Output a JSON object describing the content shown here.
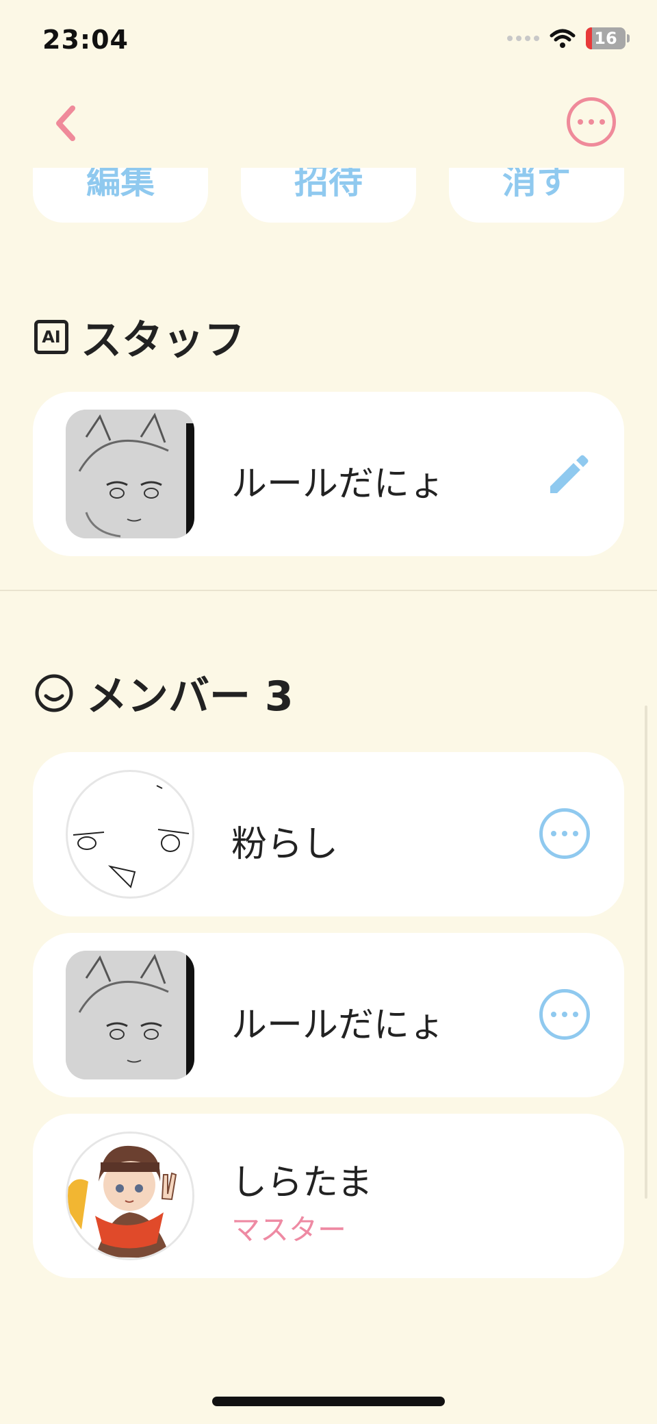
{
  "status_bar": {
    "time": "23:04",
    "battery": "16",
    "battery_level": 0.16
  },
  "nav": {
    "back_icon": "chevron-left-icon",
    "more_icon": "more-horizontal-icon"
  },
  "actions": [
    {
      "label": "編集"
    },
    {
      "label": "招待"
    },
    {
      "label": "消す"
    }
  ],
  "staff_section": {
    "icon_label": "AI",
    "title": "スタッフ",
    "items": [
      {
        "name": "ルールだにょ",
        "action_icon": "pencil-icon"
      }
    ]
  },
  "member_section": {
    "title": "メンバー 3",
    "items": [
      {
        "name": "粉らし",
        "action_icon": "more-horizontal-icon"
      },
      {
        "name": "ルールだにょ",
        "action_icon": "more-horizontal-icon"
      },
      {
        "name": "しらたま",
        "role": "マスター"
      }
    ]
  },
  "colors": {
    "background": "#fcf8e6",
    "accent_pink": "#ef8a9a",
    "accent_blue": "#8fc9ef",
    "role_pink": "#ee8aa3"
  }
}
